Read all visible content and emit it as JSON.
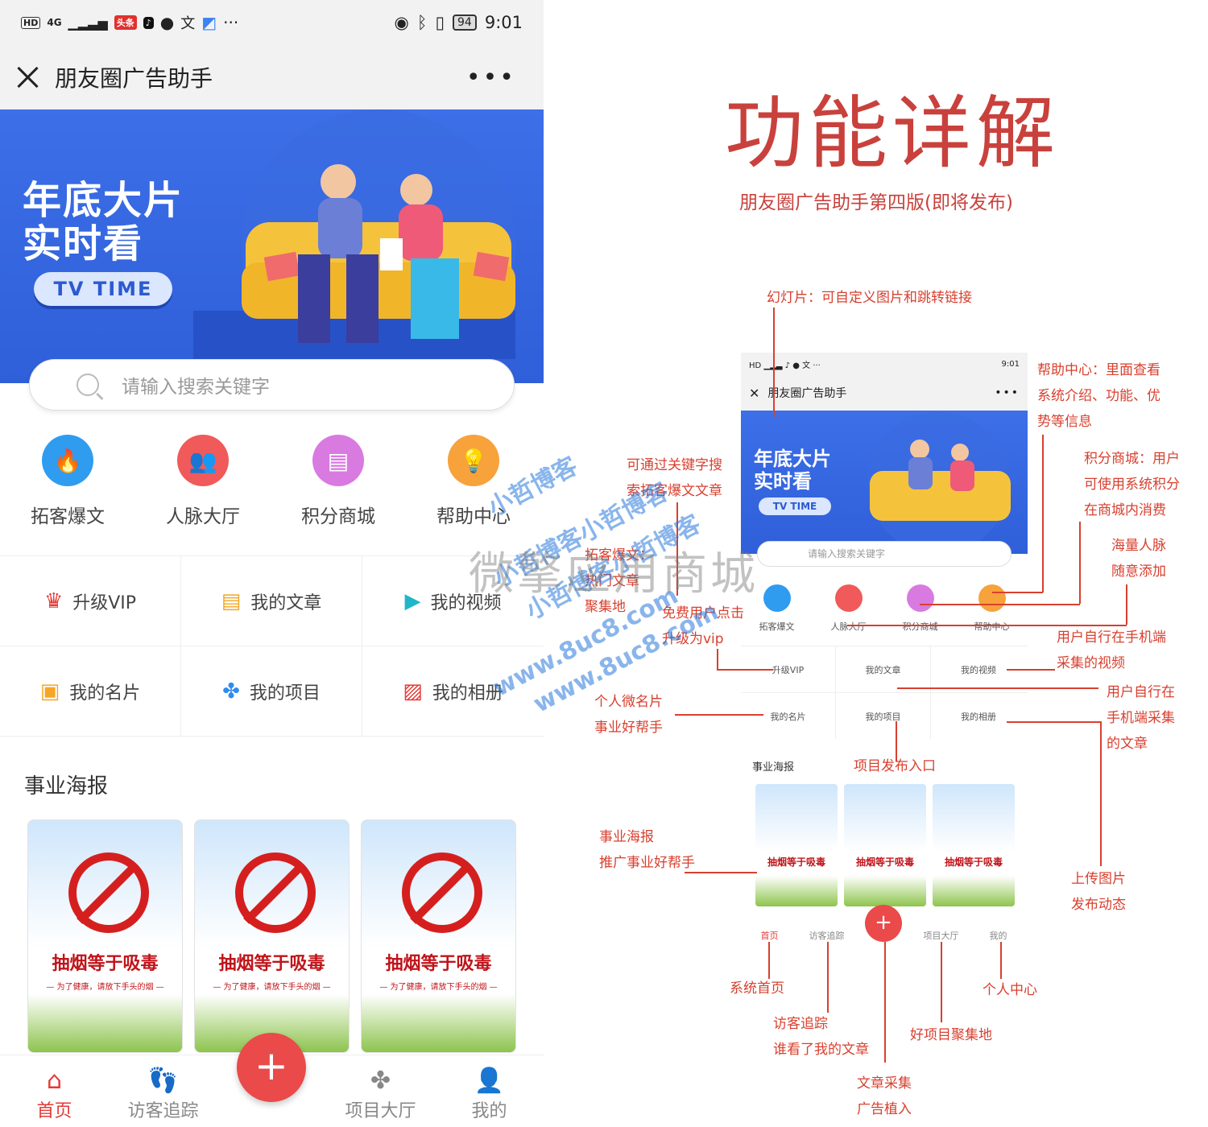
{
  "phone": {
    "status": {
      "network": "4G",
      "badge": "头条",
      "time": "9:01",
      "battery": "94"
    },
    "title": "朋友圈广告助手",
    "banner": {
      "line1": "年底大片",
      "line2": "实时看",
      "pill": "TV TIME"
    },
    "search_placeholder": "请输入搜索关键字",
    "icons": [
      {
        "label": "拓客爆文",
        "color": "#2f9cf0",
        "icon": "flame-icon"
      },
      {
        "label": "人脉大厅",
        "color": "#f05a5a",
        "icon": "people-icon"
      },
      {
        "label": "积分商城",
        "color": "#d97ae0",
        "icon": "store-icon"
      },
      {
        "label": "帮助中心",
        "color": "#f7a23b",
        "icon": "bulb-icon"
      }
    ],
    "grid": [
      [
        "升级VIP",
        "我的文章",
        "我的视频"
      ],
      [
        "我的名片",
        "我的项目",
        "我的相册"
      ]
    ],
    "poster_section": "事业海报",
    "poster_text": "抽烟等于吸毒",
    "poster_sub": "— 为了健康，请放下手头的烟 —",
    "tabs": [
      "首页",
      "访客追踪",
      "项目大厅",
      "我的"
    ],
    "fab": "+"
  },
  "right": {
    "title": "功能详解",
    "subtitle": "朋友圈广告助手第四版(即将发布)",
    "annotations": {
      "slide": "幻灯片：可自定义图片和跳转链接",
      "help": [
        "帮助中心：里面查看",
        "系统介绍、功能、优",
        "势等信息"
      ],
      "points": [
        "积分商城：用户",
        "可使用系统积分",
        "在商城内消费"
      ],
      "network": [
        "海量人脉",
        "随意添加"
      ],
      "search": [
        "可通过关键字搜",
        "索拓客爆文文章"
      ],
      "hot": [
        "拓客爆文：",
        "热门文章",
        "聚集地"
      ],
      "vip": [
        "免费用户点击",
        "升级为vip"
      ],
      "video": [
        "用户自行在手机端",
        "采集的视频"
      ],
      "article": [
        "用户自行在",
        "手机端采集",
        "的文章"
      ],
      "card": [
        "个人微名片",
        "事业好帮手"
      ],
      "project": "项目发布入口",
      "poster": [
        "事业海报",
        "推广事业好帮手"
      ],
      "upload": [
        "上传图片",
        "发布动态"
      ],
      "home": "系统首页",
      "visitor": [
        "访客追踪",
        "谁看了我的文章"
      ],
      "goodproj": "好项目聚集地",
      "personal": "个人中心",
      "collect": [
        "文章采集",
        "广告植入"
      ]
    },
    "mini": {
      "time": "9:01",
      "title": "朋友圈广告助手",
      "section": "事业海报",
      "tabs": [
        "首页",
        "访客追踪",
        "项目大厅",
        "我的"
      ]
    }
  },
  "watermarks": [
    "小哲博客",
    "小哲博客小哲博客",
    "小哲博客小哲博客",
    "www.8uc8.com",
    "www.8uc8.com",
    "微擎应用商城"
  ]
}
